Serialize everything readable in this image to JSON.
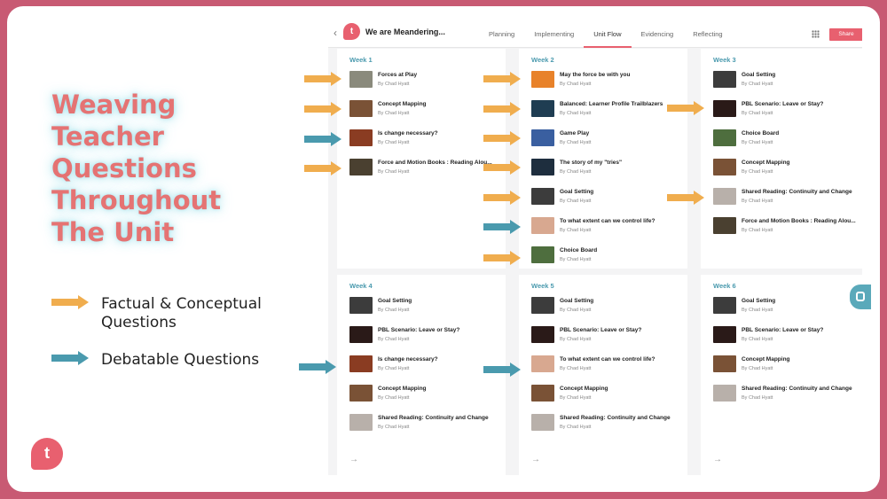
{
  "title_lines": [
    "Weaving",
    "Teacher",
    "Questions",
    "Throughout",
    "The Unit"
  ],
  "legend": [
    {
      "label": "Factual & Conceptual Questions",
      "color": "#f0ad4e"
    },
    {
      "label": "Debatable Questions",
      "color": "#4a9aae"
    }
  ],
  "logo_letter": "t",
  "colors": {
    "accent": "#e8606f",
    "orange": "#f0ad4e",
    "teal": "#4a9aae",
    "frame": "#c85a73"
  },
  "app": {
    "back_icon": "‹",
    "logo_letter": "t",
    "unit_title": "We are Meandering...",
    "tabs": [
      "Planning",
      "Implementing",
      "Unit Flow",
      "Evidencing",
      "Reflecting"
    ],
    "active_tab": "Unit Flow",
    "share_label": "Share",
    "next_icon": "→",
    "weeks": [
      {
        "label": "Week 1",
        "items": [
          {
            "title": "Forces at Play",
            "author": "By Chad Hyatt",
            "thumb": "#8a8a7c"
          },
          {
            "title": "Concept Mapping",
            "author": "By Chad Hyatt",
            "thumb": "#7a5236"
          },
          {
            "title": "Is change necessary?",
            "author": "By Chad Hyatt",
            "thumb": "#8a3c22"
          },
          {
            "title": "Force and Motion Books : Reading Alou...",
            "author": "By Chad Hyatt",
            "thumb": "#4a4030"
          }
        ]
      },
      {
        "label": "Week 2",
        "items": [
          {
            "title": "May the force be with you",
            "author": "By Chad Hyatt",
            "thumb": "#e8822a"
          },
          {
            "title": "Balanced: Learner Profile Trailblazers",
            "author": "By Chad Hyatt",
            "thumb": "#1f3d52"
          },
          {
            "title": "Game Play",
            "author": "By Chad Hyatt",
            "thumb": "#3a5fa0"
          },
          {
            "title": "The story of my \"tries\"",
            "author": "By Chad Hyatt",
            "thumb": "#1e2e3e"
          },
          {
            "title": "Goal Setting",
            "author": "By Chad Hyatt",
            "thumb": "#3c3c3c"
          },
          {
            "title": "To what extent can we control life?",
            "author": "By Chad Hyatt",
            "thumb": "#d8a890"
          },
          {
            "title": "Choice Board",
            "author": "By Chad Hyatt",
            "thumb": "#4e6e3e"
          }
        ]
      },
      {
        "label": "Week 3",
        "items": [
          {
            "title": "Goal Setting",
            "author": "By Chad Hyatt",
            "thumb": "#3c3c3c"
          },
          {
            "title": "PBL Scenario: Leave or Stay?",
            "author": "By Chad Hyatt",
            "thumb": "#2a1a18"
          },
          {
            "title": "Choice Board",
            "author": "By Chad Hyatt",
            "thumb": "#4e6e3e"
          },
          {
            "title": "Concept Mapping",
            "author": "By Chad Hyatt",
            "thumb": "#7a5236"
          },
          {
            "title": "Shared Reading: Continuity and Change",
            "author": "By Chad Hyatt",
            "thumb": "#b8b0aa"
          },
          {
            "title": "Force and Motion Books : Reading Alou...",
            "author": "By Chad Hyatt",
            "thumb": "#4a4030"
          }
        ]
      },
      {
        "label": "Week 4",
        "items": [
          {
            "title": "Goal Setting",
            "author": "By Chad Hyatt",
            "thumb": "#3c3c3c"
          },
          {
            "title": "PBL Scenario: Leave or Stay?",
            "author": "By Chad Hyatt",
            "thumb": "#2a1a18"
          },
          {
            "title": "Is change necessary?",
            "author": "By Chad Hyatt",
            "thumb": "#8a3c22"
          },
          {
            "title": "Concept Mapping",
            "author": "By Chad Hyatt",
            "thumb": "#7a5236"
          },
          {
            "title": "Shared Reading: Continuity and Change",
            "author": "By Chad Hyatt",
            "thumb": "#b8b0aa"
          }
        ]
      },
      {
        "label": "Week 5",
        "items": [
          {
            "title": "Goal Setting",
            "author": "By Chad Hyatt",
            "thumb": "#3c3c3c"
          },
          {
            "title": "PBL Scenario: Leave or Stay?",
            "author": "By Chad Hyatt",
            "thumb": "#2a1a18"
          },
          {
            "title": "To what extent can we control life?",
            "author": "By Chad Hyatt",
            "thumb": "#d8a890"
          },
          {
            "title": "Concept Mapping",
            "author": "By Chad Hyatt",
            "thumb": "#7a5236"
          },
          {
            "title": "Shared Reading: Continuity and Change",
            "author": "By Chad Hyatt",
            "thumb": "#b8b0aa"
          }
        ]
      },
      {
        "label": "Week 6",
        "items": [
          {
            "title": "Goal Setting",
            "author": "By Chad Hyatt",
            "thumb": "#3c3c3c"
          },
          {
            "title": "PBL Scenario: Leave or Stay?",
            "author": "By Chad Hyatt",
            "thumb": "#2a1a18"
          },
          {
            "title": "Concept Mapping",
            "author": "By Chad Hyatt",
            "thumb": "#7a5236"
          },
          {
            "title": "Shared Reading: Continuity and Change",
            "author": "By Chad Hyatt",
            "thumb": "#b8b0aa"
          }
        ]
      }
    ]
  }
}
